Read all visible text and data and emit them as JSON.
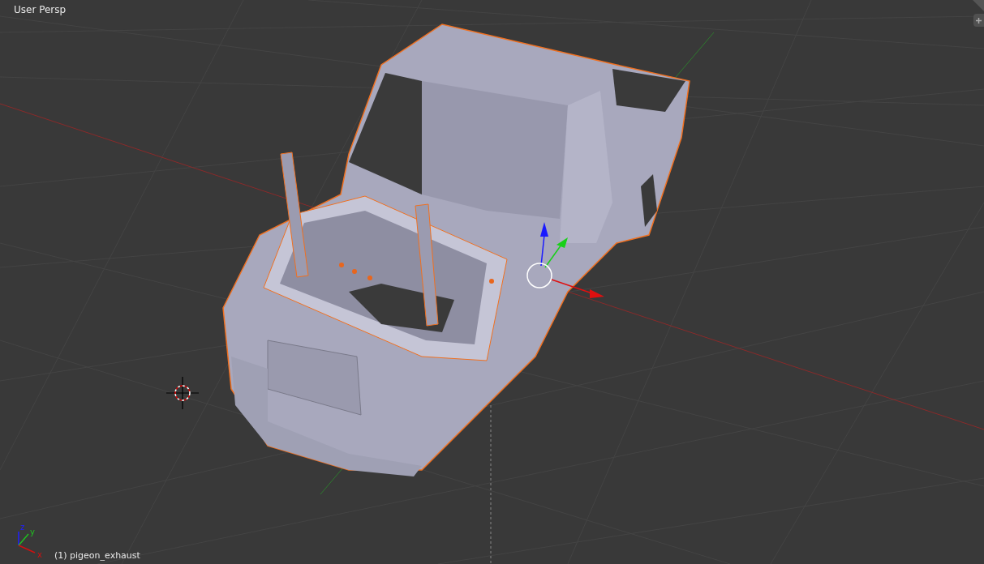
{
  "viewport": {
    "view_label": "User Persp",
    "object_label": "(1) pigeon_exhaust"
  },
  "axis_widget": {
    "labels": [
      {
        "kind": "x",
        "text": "x"
      },
      {
        "kind": "y",
        "text": "y"
      },
      {
        "kind": "z",
        "text": "z"
      }
    ]
  }
}
